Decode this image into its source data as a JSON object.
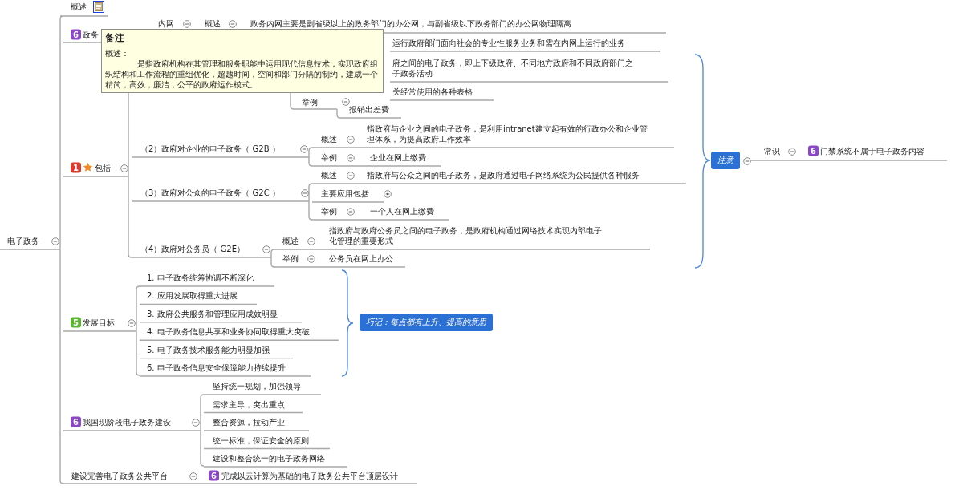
{
  "root": {
    "label": "电子政务",
    "expanded": true
  },
  "overview": {
    "label": "概述"
  },
  "government_network": {
    "badge": {
      "text": "6",
      "color": "#8a48c6"
    },
    "label": "政务",
    "intranet": {
      "label": "内网",
      "expanded": true,
      "summary": {
        "label": "概述",
        "expanded": true,
        "text": "政务内网主要是副省级以上的政务部门的办公网，与副省级以下政务部门的办公网物理隔离"
      }
    },
    "fragments": [
      {
        "lines": [
          "运行政府部门面向社会的专业性服务业务和需在内网上运行的业务"
        ]
      },
      {
        "lines": [
          "府之间的电子政务，即上下级政府、不同地方政府和不同政府部门之",
          "子政务活动"
        ]
      },
      {
        "lines": [
          "关经常使用的各种表格"
        ]
      }
    ],
    "example": {
      "label": "举例",
      "expanded": true,
      "text": "报销出差费"
    }
  },
  "includes": {
    "badge": {
      "text": "1",
      "color": "#dd3a2e"
    },
    "starred": true,
    "label": "包括",
    "expanded": true,
    "groups": [
      {
        "label": "（2）政府对企业的电子政务（ G2B ）",
        "expanded": true,
        "children": [
          {
            "label": "概述",
            "expanded": true,
            "lines": [
              "指政府与企业之间的电子政务，是利用intranet建立起有效的行政办公和企业管",
              "理体系，为提高政府工作效率"
            ]
          },
          {
            "label": "举例",
            "expanded": true,
            "lines": [
              "企业在网上缴费"
            ]
          }
        ]
      },
      {
        "label": "（3）政府对公众的电子政务（ G2C ）",
        "expanded": true,
        "children": [
          {
            "label": "概述",
            "expanded": true,
            "lines": [
              "指政府与公众之间的电子政务，是政府通过电子网络系统为公民提供各种服务"
            ]
          },
          {
            "label": "主要应用包括",
            "expanded": false
          },
          {
            "label": "举例",
            "expanded": true,
            "lines": [
              "一个人在网上缴费"
            ]
          }
        ]
      },
      {
        "label": "（4）政府对公务员（ G2E）",
        "expanded": true,
        "children": [
          {
            "label": "概述",
            "expanded": true,
            "lines": [
              "指政府与政府公务员之间的电子政务，是政府机构通过网络技术实现内部电子",
              "化管理的重要形式"
            ]
          },
          {
            "label": "举例",
            "expanded": true,
            "lines": [
              "公务员在网上办公"
            ]
          }
        ]
      }
    ]
  },
  "goals": {
    "badge": {
      "text": "5",
      "color": "#5cb531"
    },
    "label": "发展目标",
    "expanded": true,
    "items": [
      "1. 电子政务统筹协调不断深化",
      "2. 应用发展取得重大进展",
      "3. 政府公共服务和管理应用成效明显",
      "4. 电子政务信息共享和业务协同取得重大突破",
      "5. 电子政务技术服务能力明显加强",
      "6. 电子政务信息安全保障能力持续提升"
    ],
    "summary": "巧记：每点都有上升、提高的意思"
  },
  "construction": {
    "badge": {
      "text": "6",
      "color": "#8a48c6"
    },
    "label": "我国现阶段电子政务建设",
    "expanded": true,
    "items": [
      "坚持统一规划，加强领导",
      "需求主导，突出重点",
      "整合资源，拉动产业",
      "统一标准，保证安全的原则",
      "建设和整合统一的电子政务网络"
    ]
  },
  "platform": {
    "label": "建设完善电子政务公共平台",
    "expanded": true,
    "child": {
      "badge": {
        "text": "6",
        "color": "#8a48c6"
      },
      "text": "完成以云计算为基础的电子政务公共平台顶层设计"
    }
  },
  "callout": {
    "label": "注意",
    "expanded": true,
    "child": {
      "label": "常识",
      "expanded": true,
      "badge": {
        "text": "6",
        "color": "#8a48c6"
      },
      "text": "门禁系统不属于电子政务内容"
    }
  },
  "note_popup": {
    "title": "备注",
    "heading": "概述：",
    "text": "是指政府机构在其管理和服务职能中运用现代信息技术，实现政府组织结构和工作流程的重组优化，超越时间，空间和部门分隔的制约，建成一个精简，高效，廉洁，公平的政府运作模式。"
  }
}
